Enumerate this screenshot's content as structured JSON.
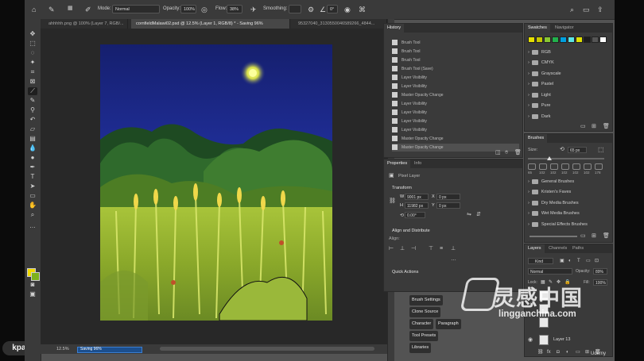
{
  "options_bar": {
    "mode_label": "Mode:",
    "mode_value": "Normal",
    "opacity_label": "Opacity:",
    "opacity_value": "100%",
    "flow_label": "Flow:",
    "flow_value": "38%",
    "smoothing_label": "Smoothing:",
    "angle_value": "0°"
  },
  "tabs": [
    {
      "label": "ahhhhh.png @ 100% (Layer 7, RGB/..."
    },
    {
      "label": "cornfieldMalawi02.psd @ 12.5% (Layer 1, RGB/8) * - Saving 96%"
    },
    {
      "label": "95327040_3130550046589266_4844..."
    }
  ],
  "status": {
    "zoom": "12.5%",
    "saving": "Saving 96%"
  },
  "history": {
    "title": "History",
    "items": [
      "Brush Tool",
      "Brush Tool",
      "Brush Tool",
      "Brush Tool (Save)",
      "Layer Visibility",
      "Layer Visibility",
      "Master Opacity Change",
      "Layer Visibility",
      "Layer Visibility",
      "Layer Visibility",
      "Layer Visibility",
      "Master Opacity Change",
      "Master Opacity Change"
    ]
  },
  "properties": {
    "tab_properties": "Properties",
    "tab_info": "Info",
    "pixel_layer": "Pixel Layer",
    "transform_title": "Transform",
    "w_label": "W",
    "w_value": "9001 px",
    "x_label": "X",
    "x_value": "0 px",
    "h_label": "H",
    "h_value": "11982 px",
    "y_label": "Y",
    "y_value": "0 px",
    "angle_value": "0.00°",
    "align_title": "Align and Distribute",
    "align_label": "Align:",
    "quick_actions": "Quick Actions"
  },
  "bottom_tabs": {
    "brush_settings": "Brush Settings",
    "clone_source": "Clone Source",
    "character": "Character",
    "paragraph": "Paragraph",
    "tool_presets": "Tool Presets",
    "libraries": "Libraries"
  },
  "swatches": {
    "tab_swatches": "Swatches",
    "tab_navigator": "Navigator",
    "colors": [
      "#e6e000",
      "#c8c800",
      "#8ac832",
      "#22b14c",
      "#00a0e0",
      "#5ce6e6",
      "#e0e000",
      "#1e1e1e",
      "#555555",
      "#ffffff"
    ],
    "folders": [
      "RGB",
      "CMYK",
      "Grayscale",
      "Pastel",
      "Light",
      "Pure",
      "Dark"
    ]
  },
  "brushes": {
    "title": "Brushes",
    "size_label": "Size:",
    "size_value": "65 px",
    "presets": [
      "65",
      "102",
      "102",
      "102",
      "102",
      "102",
      "178"
    ],
    "folders": [
      "General Brushes",
      "Kristen's Faves",
      "Dry Media Brushes",
      "Wet Media Brushes",
      "Special Effects Brushes"
    ]
  },
  "layers": {
    "tab_layers": "Layers",
    "tab_channels": "Channels",
    "tab_paths": "Paths",
    "kind_label": "Kind",
    "blend_mode": "Normal",
    "opacity_label": "Opacity:",
    "opacity_value": "89%",
    "lock_label": "Lock:",
    "fill_label": "Fill:",
    "fill_value": "100%",
    "layer_bottom": "Layer 13"
  },
  "watermark": {
    "cn": "灵感中国",
    "url": "lingganchina.com",
    "left": "kpalana.com",
    "udemy": "Udemy"
  }
}
